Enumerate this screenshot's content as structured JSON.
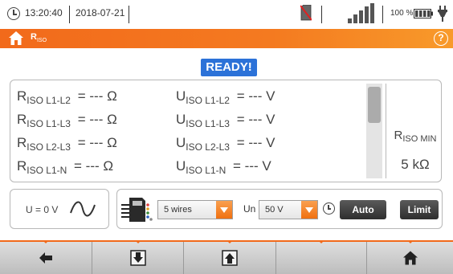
{
  "status": {
    "time": "13:20:40",
    "date": "2018-07-21",
    "battery": "100 %",
    "icons": [
      "clock-icon",
      "no-sd-card-icon",
      "signal-strength-icon",
      "battery-icon",
      "charging-plug-icon"
    ]
  },
  "header": {
    "title_main": "R",
    "title_sub": "ISO",
    "home_icon": "home-icon",
    "help_label": "?"
  },
  "ready": "READY!",
  "results": {
    "rows": [
      {
        "r_sym": "R",
        "r_sub": "ISO L1-L2",
        "r_val": "= --- Ω",
        "u_sym": "U",
        "u_sub": "ISO L1-L2",
        "u_val": "= --- V"
      },
      {
        "r_sym": "R",
        "r_sub": "ISO L1-L3",
        "r_val": "= --- Ω",
        "u_sym": "U",
        "u_sub": "ISO L1-L3",
        "u_val": "= --- V"
      },
      {
        "r_sym": "R",
        "r_sub": "ISO L2-L3",
        "r_val": "= --- Ω",
        "u_sym": "U",
        "u_sub": "ISO L2-L3",
        "u_val": "= --- V"
      },
      {
        "r_sym": "R",
        "r_sub": "ISO L1-N",
        "r_val": "= --- Ω",
        "u_sym": "U",
        "u_sub": "ISO L1-N",
        "u_val": "= --- V"
      }
    ],
    "rmin_sym": "R",
    "rmin_sub": "ISO MIN",
    "rmin_value": "5 kΩ"
  },
  "voltage": {
    "text": "U = 0 V",
    "icon": "sine-wave-icon"
  },
  "controls": {
    "adapter_icon": "multi-wire-adapter-icon",
    "wires_value": "5 wires",
    "un_label": "Un",
    "un_value": "50 V",
    "timer_icon": "clock-icon",
    "auto_label": "Auto",
    "limit_label": "Limit"
  },
  "nav": {
    "icons": [
      "back-arrow-icon",
      "download-icon",
      "upload-icon",
      "",
      "home-icon"
    ]
  },
  "colors": {
    "accent": "#f26a1b",
    "ready_bg": "#2c72d8"
  }
}
